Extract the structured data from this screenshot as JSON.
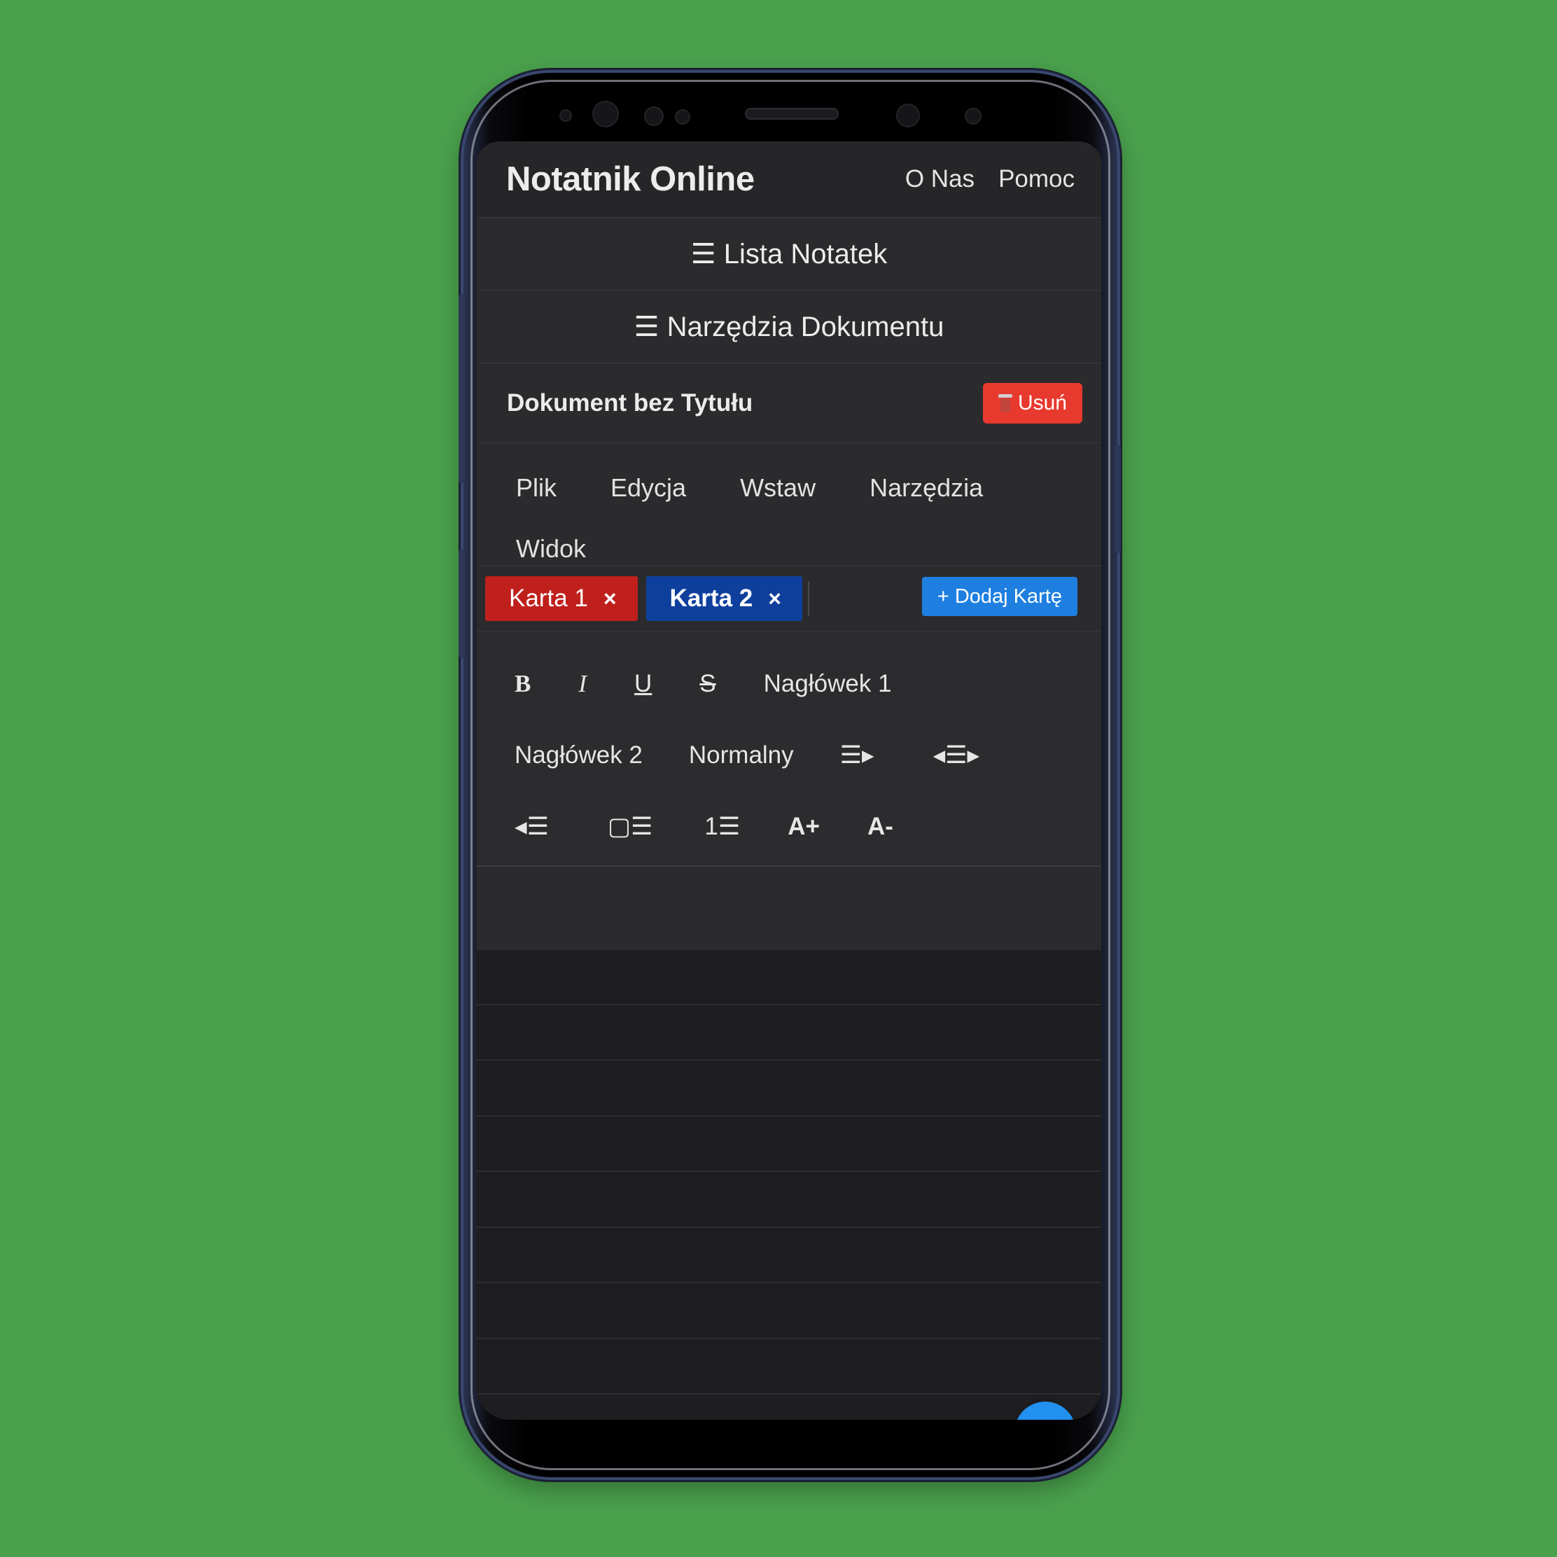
{
  "navbar": {
    "brand": "Notatnik Online",
    "links": [
      "O Nas",
      "Pomoc"
    ]
  },
  "toggles": {
    "notes_list": "☰ Lista Notatek",
    "doc_tools": "☰ Narzędzia Dokumentu"
  },
  "document": {
    "title": "Dokument bez Tytułu",
    "delete_label": "Usuń"
  },
  "menu": [
    "Plik",
    "Edycja",
    "Wstaw",
    "Narzędzia",
    "Widok"
  ],
  "tabs": {
    "items": [
      {
        "label": "Karta 1",
        "close": "×",
        "color": "#c0201c"
      },
      {
        "label": "Karta 2",
        "close": "×",
        "color": "#0f3f9c"
      }
    ],
    "add_label": "+ Dodaj Kartę"
  },
  "toolbar": {
    "bold": "B",
    "italic": "I",
    "underline": "U",
    "strike": "S",
    "heading1": "Nagłówek 1",
    "heading2": "Nagłówek 2",
    "normal": "Normalny",
    "align_right": "☰▸",
    "align_center": "◂☰▸",
    "align_left": "◂☰",
    "bullet_list": "▢☰",
    "numbered_list": "1☰",
    "font_increase": "A+",
    "font_decrease": "A-"
  },
  "fab": {
    "icon": "⤢"
  },
  "colors": {
    "background": "#4aa14c",
    "accent": "#1f7fe0",
    "danger": "#e8392f"
  }
}
